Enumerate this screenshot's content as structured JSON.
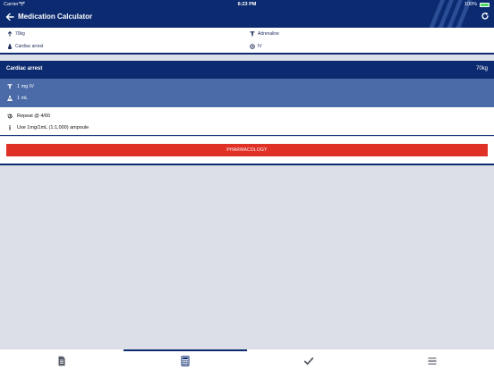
{
  "status_bar": {
    "carrier": "Carrier",
    "time": "6:23 PM",
    "battery": "100%"
  },
  "nav": {
    "title": "Medication Calculator",
    "back_icon": "back-arrow-icon",
    "refresh_icon": "refresh-icon"
  },
  "info": {
    "weight": "70kg",
    "condition": "Cardiac arrest",
    "drug": "Adrenaline",
    "route": "IV"
  },
  "card": {
    "title": "Cardiac arrest",
    "weight": "70kg",
    "dose": "1 mg IV",
    "volume": "1 mL",
    "repeat": "Repeat @ 4/60",
    "note": "Use 1mg/1mL (1:1,000) ampoule"
  },
  "pharmacology_button": "PHARMACOLOGY",
  "tabs": [
    {
      "name": "document-icon"
    },
    {
      "name": "calculator-icon",
      "active": true
    },
    {
      "name": "checkmark-icon"
    },
    {
      "name": "menu-icon"
    }
  ],
  "colors": {
    "navy": "#0b2a6f",
    "dose_band": "#4a6aa8",
    "button_red": "#e03127",
    "background": "#dcdfe8"
  }
}
